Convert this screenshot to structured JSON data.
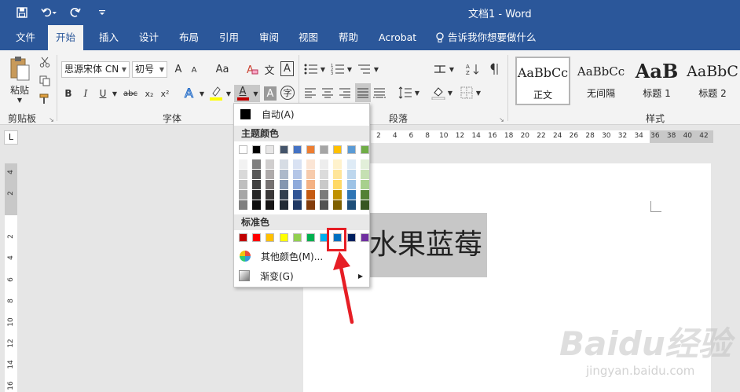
{
  "titlebar": {
    "title": "文档1  -  Word",
    "bg": "#2b579a"
  },
  "tabs": [
    {
      "label": "文件"
    },
    {
      "label": "开始"
    },
    {
      "label": "插入"
    },
    {
      "label": "设计"
    },
    {
      "label": "布局"
    },
    {
      "label": "引用"
    },
    {
      "label": "审阅"
    },
    {
      "label": "视图"
    },
    {
      "label": "帮助"
    },
    {
      "label": "Acrobat"
    },
    {
      "label": "告诉我你想要做什么"
    }
  ],
  "active_tab": "开始",
  "ribbon": {
    "clipboard": {
      "paste": "粘贴",
      "group": "剪贴板"
    },
    "font": {
      "font_name": "思源宋体 CN",
      "font_size": "初号",
      "group": "字体",
      "bold": "B",
      "italic": "I",
      "underline": "U",
      "strike": "abc",
      "subscript": "x₂",
      "superscript": "x²",
      "case": "Aa",
      "grow": "A",
      "shrink": "A",
      "color_letter": "A",
      "wen": "文",
      "char_border": "A",
      "char_shade": "A",
      "phonetic": "字"
    },
    "paragraph": {
      "group": "段落"
    },
    "styles": {
      "group": "样式",
      "items": [
        {
          "sample": "AaBbCc",
          "name": "正文"
        },
        {
          "sample": "AaBbCc",
          "name": "无间隔"
        },
        {
          "sample": "AaB",
          "name": "标题 1"
        },
        {
          "sample": "AaBbC",
          "name": "标题 2"
        }
      ]
    }
  },
  "ruler": {
    "corner": "L",
    "h_numbers": [
      "2",
      "4",
      "6",
      "8",
      "10",
      "12",
      "14",
      "16",
      "18",
      "20",
      "22",
      "24",
      "26",
      "28",
      "30",
      "32",
      "34",
      "36",
      "38",
      "40",
      "42"
    ],
    "v_numbers": [
      "4",
      "2",
      "2",
      "4",
      "6",
      "8",
      "10",
      "12",
      "14",
      "16"
    ]
  },
  "document": {
    "selected_text": "水果蓝莓",
    "highlight": "#c7c7c7"
  },
  "color_menu": {
    "auto": "自动(A)",
    "theme_header": "主题颜色",
    "theme_top": [
      "#ffffff",
      "#000000",
      "#e7e6e6",
      "#44546a",
      "#4472c4",
      "#ed7d31",
      "#a5a5a5",
      "#ffc000",
      "#5b9bd5",
      "#70ad47"
    ],
    "theme_shades": [
      [
        "#f2f2f2",
        "#d9d9d9",
        "#bfbfbf",
        "#a6a6a6",
        "#7f7f7f"
      ],
      [
        "#7f7f7f",
        "#595959",
        "#404040",
        "#262626",
        "#0d0d0d"
      ],
      [
        "#d0cece",
        "#aeaaaa",
        "#757171",
        "#3a3838",
        "#171616"
      ],
      [
        "#d6dce4",
        "#adb9ca",
        "#8496b0",
        "#323f4f",
        "#222a35"
      ],
      [
        "#d9e2f3",
        "#b4c6e7",
        "#8eaadb",
        "#2f5496",
        "#1f3864"
      ],
      [
        "#fbe5d5",
        "#f7cbac",
        "#f4b183",
        "#c55a11",
        "#833c0b"
      ],
      [
        "#ededed",
        "#dbdbdb",
        "#c9c9c9",
        "#7b7b7b",
        "#525252"
      ],
      [
        "#fff2cc",
        "#ffe599",
        "#ffd966",
        "#bf9000",
        "#7f6000"
      ],
      [
        "#deebf6",
        "#bdd7ee",
        "#9dc3e6",
        "#2e75b5",
        "#1e4e79"
      ],
      [
        "#e2efd9",
        "#c5e0b3",
        "#a8d08d",
        "#538135",
        "#375623"
      ]
    ],
    "standard_header": "标准色",
    "standard": [
      "#c00000",
      "#ff0000",
      "#ffc000",
      "#ffff00",
      "#92d050",
      "#00b050",
      "#00b0f0",
      "#0070c0",
      "#002060",
      "#7030a0"
    ],
    "more_colors": "其他颜色(M)...",
    "gradient": "渐变(G)",
    "highlight_color": "#e61e25"
  },
  "watermark": {
    "logo": "Baidu经验",
    "url": "jingyan.baidu.com"
  }
}
